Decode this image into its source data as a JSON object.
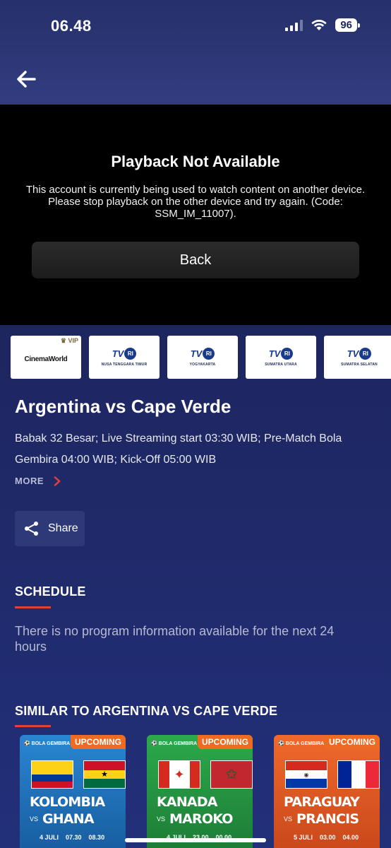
{
  "status": {
    "time": "06.48",
    "battery": "96"
  },
  "player": {
    "title": "Playback Not Available",
    "message": "This account is currently being used to watch content on another device. Please stop playback on the other device and try again. (Code: SSM_IM_11007).",
    "back_label": "Back"
  },
  "channels": [
    {
      "name": "CinemaWorld",
      "sub": "",
      "vip": "VIP"
    },
    {
      "name": "TVRI",
      "sub": "NUSA TENGGARA TIMUR"
    },
    {
      "name": "TVRI",
      "sub": "YOGYAKARTA"
    },
    {
      "name": "TVRI",
      "sub": "SUMATRA UTARA"
    },
    {
      "name": "TVRI",
      "sub": "SUMATRA SELATAN"
    }
  ],
  "event": {
    "title": "Argentina vs Cape Verde",
    "description": "Babak 32 Besar; Live Streaming start 03:30 WIB; Pre-Match Bola Gembira 04:00 WIB; Kick-Off 05:00 WIB",
    "more_label": "MORE",
    "share_label": "Share"
  },
  "schedule": {
    "title": "SCHEDULE",
    "empty_text": "There is no program information available for the next 24 hours"
  },
  "similar": {
    "title": "SIMILAR TO  ARGENTINA VS CAPE VERDE",
    "cards": [
      {
        "badge": "UPCOMING",
        "team1": "KOLOMBIA",
        "vs": "VS",
        "team2": "GHANA",
        "date": "4 JULI",
        "t1": "07.30",
        "t2": "08.30",
        "bg": "#1f6fb5"
      },
      {
        "badge": "UPCOMING",
        "team1": "KANADA",
        "vs": "VS",
        "team2": "MAROKO",
        "date": "4 JULI",
        "t1": "23.00",
        "t2": "00.00",
        "bg": "#23983f"
      },
      {
        "badge": "UPCOMING",
        "team1": "PARAGUAY",
        "vs": "VS",
        "team2": "PRANCIS",
        "date": "5 JULI",
        "t1": "03.00",
        "t2": "04.00",
        "bg": "#e3531f"
      }
    ]
  },
  "colors": {
    "accent_red": "#e2413b",
    "badge_orange": "#ed6b22",
    "background": "#1e2660"
  }
}
